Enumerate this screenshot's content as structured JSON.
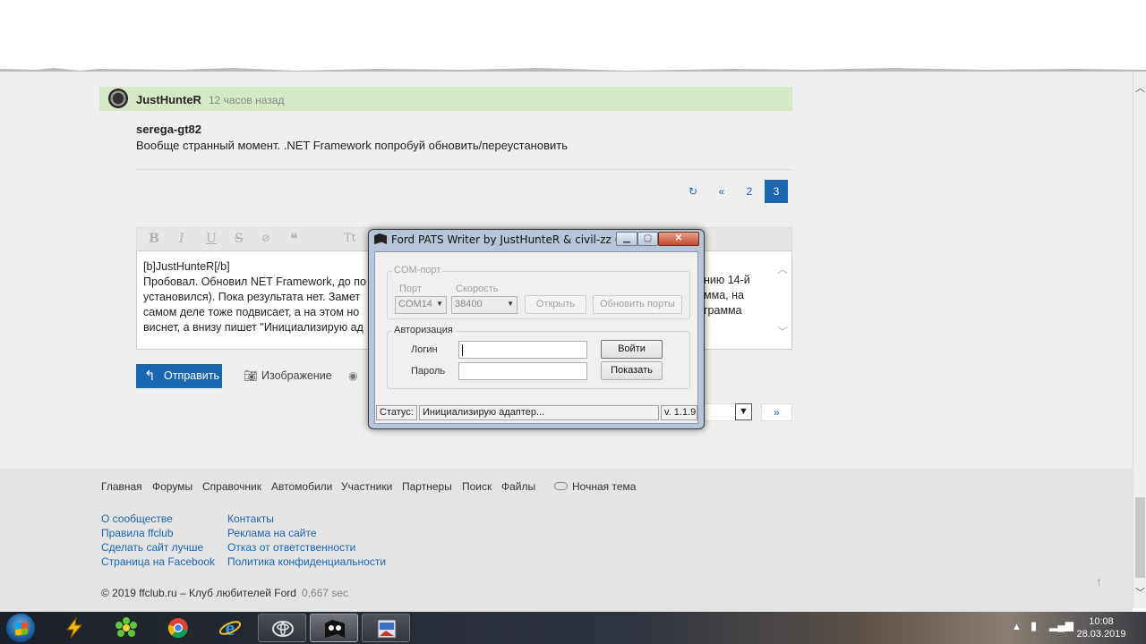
{
  "post": {
    "author": "JustHunteR",
    "time_ago": "12 часов назад",
    "quoted_user": "serega-gt82",
    "text": "Вообще странный момент. .NET Framework попробуй обновить/переустановить"
  },
  "pagination": {
    "refresh_icon": "↻",
    "prev": "«",
    "pages": [
      "2",
      "3"
    ],
    "current": "3"
  },
  "editor": {
    "toolbar_icons": [
      "B",
      "I",
      "U",
      "S",
      "eye-off",
      "quote",
      "Tt"
    ],
    "lines": [
      "[b]JustHunteR[/b]",
      "Пробовал. Обновил NET Framework, до по",
      "установился). Пока результата нет. Замет",
      "самом деле тоже подвисает, а на этом но",
      "виснет, а внизу пишет \"Инициализирую ад"
    ],
    "lines_right": [
      "",
      "нию 14-й",
      "мма, на",
      "грамма",
      ""
    ],
    "send_label": "Отправить",
    "image_label": "Изображение",
    "next_label": "»"
  },
  "footer": {
    "nav": [
      "Главная",
      "Форумы",
      "Справочник",
      "Автомобили",
      "Участники",
      "Партнеры",
      "Поиск",
      "Файлы"
    ],
    "night_theme": "Ночная тема",
    "links_col1": [
      "О сообществе",
      "Правила ffclub",
      "Сделать сайт лучше",
      "Страница на Facebook"
    ],
    "links_col2": [
      "Контакты",
      "Реклама на сайте",
      "Отказ от ответственности",
      "Политика конфиденциальности"
    ],
    "copyright": "© 2019 ffclub.ru – Клуб любителей Ford",
    "timing": "0,667 sec"
  },
  "dialog": {
    "title": "Ford PATS Writer by JustHunteR & civil-zz (He ...",
    "com_group": "COM-порт",
    "port_label": "Порт",
    "port_value": "COM14",
    "speed_label": "Скорость",
    "speed_value": "38400",
    "open_button": "Открыть",
    "refresh_ports_button": "Обновить порты",
    "auth_group": "Авторизация",
    "login_label": "Логин",
    "password_label": "Пароль",
    "login_button": "Войти",
    "show_button": "Показать",
    "status_label": "Статус:",
    "status_text": "Инициализирую адаптер...",
    "version": "v. 1.1.9"
  },
  "taskbar": {
    "clock_time": "10:08",
    "clock_date": "28.03.2019",
    "icons": [
      "aimp-icon",
      "icq-icon",
      "chrome-icon",
      "ie-icon",
      "toyota-icon",
      "pats-writer-icon",
      "app-icon"
    ]
  },
  "colors": {
    "accent": "#1a66b0",
    "post_header": "#d6e9c6",
    "footer_bg": "#e4e4e4"
  }
}
